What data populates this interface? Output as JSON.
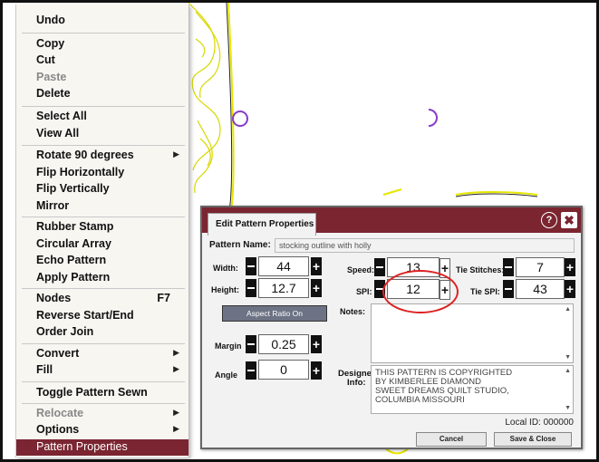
{
  "menu": {
    "items": [
      {
        "label": "Undo"
      },
      {
        "label": "Copy"
      },
      {
        "label": "Cut"
      },
      {
        "label": "Paste",
        "disabled": true
      },
      {
        "label": "Delete"
      },
      {
        "label": "Select All"
      },
      {
        "label": "View All"
      },
      {
        "label": "Rotate 90 degrees",
        "submenu": true
      },
      {
        "label": "Flip Horizontally"
      },
      {
        "label": "Flip Vertically"
      },
      {
        "label": "Mirror"
      },
      {
        "label": "Rubber Stamp"
      },
      {
        "label": "Circular Array"
      },
      {
        "label": "Echo Pattern"
      },
      {
        "label": "Apply Pattern"
      },
      {
        "label": "Nodes",
        "shortcut": "F7"
      },
      {
        "label": "Reverse Start/End"
      },
      {
        "label": "Order Join"
      },
      {
        "label": "Convert",
        "submenu": true
      },
      {
        "label": "Fill",
        "submenu": true
      },
      {
        "label": "Toggle Pattern Sewn"
      },
      {
        "label": "Relocate",
        "submenu": true,
        "disabled": true
      },
      {
        "label": "Options",
        "submenu": true
      },
      {
        "label": "Pattern Properties",
        "selected": true
      }
    ]
  },
  "dialog": {
    "tab_title": "Edit Pattern Properties",
    "help_glyph": "?",
    "close_glyph": "✖",
    "pattern_name_label": "Pattern Name:",
    "pattern_name_value": "stocking outline with holly",
    "width_label": "Width:",
    "width_value": "44",
    "height_label": "Height:",
    "height_value": "12.7",
    "aspect_button": "Aspect Ratio On",
    "margin_label": "Margin",
    "margin_value": "0.25",
    "angle_label": "Angle",
    "angle_value": "0",
    "speed_label": "Speed:",
    "speed_value": "13",
    "spi_label": "SPI:",
    "spi_value": "12",
    "tie_stitches_label": "Tie Stitches:",
    "tie_stitches_value": "7",
    "tie_spi_label": "Tie SPI:",
    "tie_spi_value": "43",
    "notes_label": "Notes:",
    "designer_info_label_1": "Designer",
    "designer_info_label_2": "Info:",
    "designer_info_value": "THIS PATTERN IS COPYRIGHTED\nBY KIMBERLEE DIAMOND\nSWEET DREAMS QUILT STUDIO,\nCOLUMBIA MISSOURI",
    "local_id_label": "Local ID:",
    "local_id_value": "000000",
    "cancel_button": "Cancel",
    "save_button": "Save & Close"
  },
  "colors": {
    "accent": "#7b2531",
    "pattern_line": "#e6e600",
    "circle": "#8a3cc7",
    "highlight": "#dd2222"
  }
}
